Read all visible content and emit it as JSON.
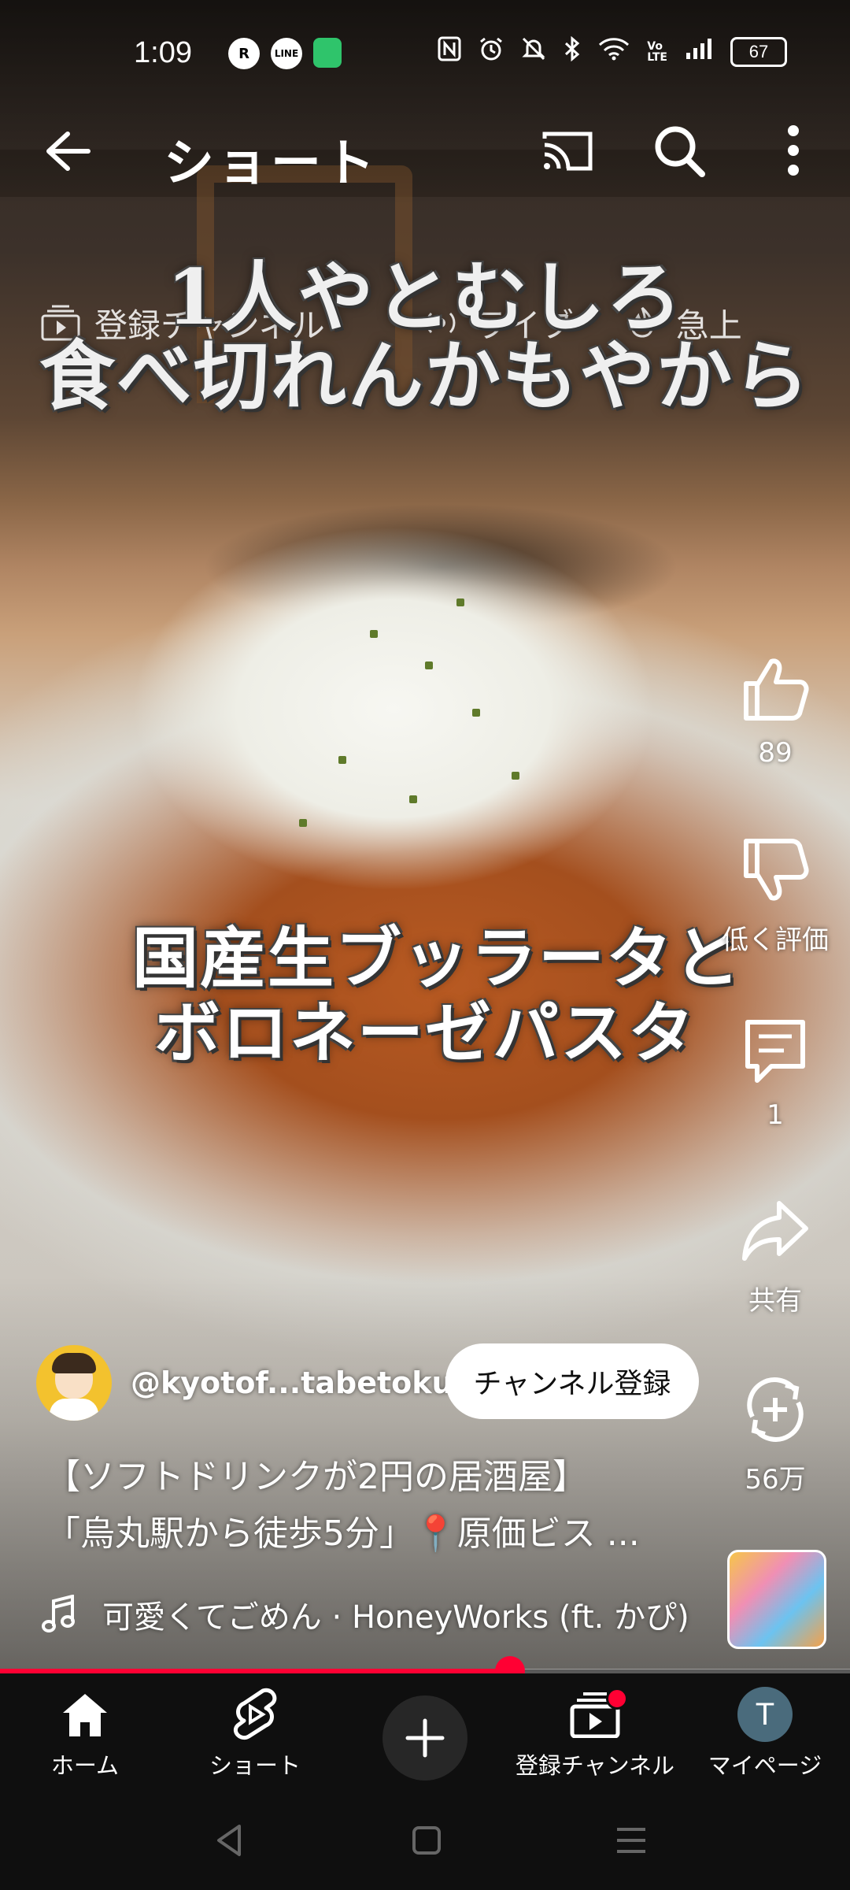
{
  "status_bar": {
    "time": "1:09",
    "left_icons": [
      "rakuten-link-icon",
      "line-icon",
      "battery-app-icon"
    ],
    "right_icons": [
      "nfc-icon",
      "alarm-icon",
      "mute-icon",
      "bluetooth-icon",
      "wifi-icon",
      "volte-icon",
      "signal-icon"
    ],
    "battery": "67"
  },
  "topbar": {
    "title": "ショート",
    "icons": [
      "back-arrow-icon",
      "cast-icon",
      "search-icon",
      "more-vert-icon"
    ]
  },
  "chips": [
    {
      "label": "登録チャンネル",
      "icon": "subscriptions-icon"
    },
    {
      "label": "ライブ",
      "icon": "live-icon"
    },
    {
      "label": "急上",
      "icon": "trending-icon"
    }
  ],
  "video_captions": {
    "line1": "1人やとむしろ",
    "line2": "食べ切れんかもやから",
    "line3": "国産生ブッラータと",
    "line4": "ボロネーゼパスタ"
  },
  "actions": {
    "like_count": "89",
    "dislike_label": "低く評価",
    "comment_count": "1",
    "share_label": "共有",
    "remix_count": "56万"
  },
  "channel": {
    "handle": "@kyotof...tabetoku",
    "subscribe_label": "チャンネル登録"
  },
  "description": {
    "line1": "【ソフトドリンクが2円の居酒屋】",
    "line2": "「烏丸駅から徒歩5分」📍原価ビス ..."
  },
  "music": {
    "title": "可愛くてごめん · HoneyWorks (ft. かぴ)"
  },
  "progress": {
    "fraction": 0.6
  },
  "bottom_nav": {
    "home": "ホーム",
    "shorts": "ショート",
    "subscriptions": "登録チャンネル",
    "mypage": "マイページ",
    "avatar_letter": "T"
  },
  "colors": {
    "accent_red": "#ff0033",
    "nav_bg": "#0f0f0f"
  }
}
